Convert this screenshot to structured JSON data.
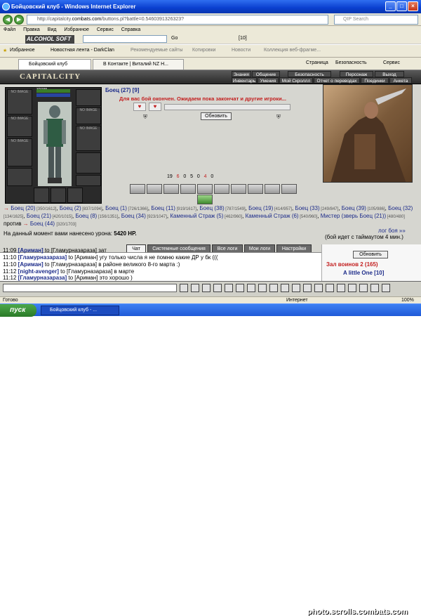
{
  "window": {
    "title": "Бойцовский клуб - Windows Internet Explorer",
    "min": "_",
    "max": "□",
    "close": "×"
  },
  "address": {
    "url_prefix": "http://capitalcity.",
    "url_domain": "combats.com",
    "url_path": "/buttons.pl?battle=0.5460391326323?",
    "search_placeholder": "QIP Search",
    "go": "Go"
  },
  "menu": [
    "Файл",
    "Правка",
    "Вид",
    "Избранное",
    "Сервис",
    "Справка"
  ],
  "toolbar": {
    "brand": "ALCOHOL SOFT",
    "counter": "[10]"
  },
  "favbar": {
    "favorites": "Избранное",
    "news": "Новостная лента - DarkClan",
    "recommended": "Рекомендуемые сайты",
    "kotirovki": "Котировки",
    "novosti": "Новости",
    "collection": "Коллекция веб-фрагме...",
    "page": "Страница",
    "security": "Безопасность",
    "service": "Сервис"
  },
  "tabs": [
    "Бойцовский клуб",
    "В Контакте | Виталий NZ Н..."
  ],
  "game": {
    "logo": "CAPITALCITY",
    "nav_top": [
      "Знания",
      "Общение",
      "Безопасность",
      "Персонаж",
      "Выход"
    ],
    "nav_bottom": [
      "Инвентарь",
      "Умения",
      "Мой Скроллл",
      "Отчет о переводах",
      "Поединки",
      "Анкета"
    ],
    "hp": "3?/155",
    "mana": "3?/155",
    "fighter_title": "Боец (27) [9]",
    "fight_over": "Для вас бой окончен. Ожидаем пока закончат и другие игроки...",
    "refresh": "Обновить",
    "noimage": "NO IMAGE",
    "stats": [
      "19",
      "6",
      "0",
      "5",
      "0",
      "4",
      "0"
    ],
    "damage_label": "На данный момент вами нанесено урона:",
    "damage_value": "5420 HP.",
    "log_link": "лог боя »»",
    "timeout_note": "(бой идет с таймаутом 4 мин.)"
  },
  "team_left": [
    {
      "name": "Боец (20)",
      "hp": "[350/1612]"
    },
    {
      "name": "Боец (2)",
      "hp": "[837/1094]"
    },
    {
      "name": "Боец (1)",
      "hp": "[726/1366]"
    },
    {
      "name": "Боец (11)",
      "hp": "[919/1617]"
    },
    {
      "name": "Боец (38)",
      "hp": "[787/1549]"
    },
    {
      "name": "Боец (19)",
      "hp": "[414/957]"
    },
    {
      "name": "Боец (33)",
      "hp": "[249/847]"
    },
    {
      "name": "Боец (39)",
      "hp": "[105/986]"
    },
    {
      "name": "Боец (32)",
      "hp": "[134/1625]"
    },
    {
      "name": "Боец (21)",
      "hp": "[420/1015]"
    },
    {
      "name": "Боец (8)",
      "hp": "[156/1351]"
    },
    {
      "name": "Боец (34)",
      "hp": "[923/1047]"
    },
    {
      "name": "Каменный Страж (5)",
      "hp": "[462/960]"
    },
    {
      "name": "Каменный Страж (6)",
      "hp": "[540/960]"
    },
    {
      "name": "Мистер (зверь Боец (21))",
      "hp": "[480/480]"
    }
  ],
  "versus": "против",
  "team_right": {
    "name": "Боец (44)",
    "hp": "[320/1703]"
  },
  "chat_tabs": [
    "Чат",
    "Системные сообщения",
    "Все логи",
    "Мои логи",
    "Настройки"
  ],
  "chat": [
    {
      "time": "11:09",
      "from": "[Ариман]",
      "to": "to [Гламурназараза]",
      "msg": "зат"
    },
    {
      "time": "11:10",
      "from": "[Гламурназараза]",
      "to": "to [Ариман]",
      "msg": "угу только числа я не помню какие ДР у бк (((",
      "bold": true
    },
    {
      "time": "11:10",
      "from": "[Ариман]",
      "to": "to [Гламурназараза]",
      "msg": "в районе великого 8-го марта :)"
    },
    {
      "time": "11:12",
      "from": "[night-avenger]",
      "to": "to [Гламурназараза]",
      "msg": "в марте"
    },
    {
      "time": "11:12",
      "from": "[Гламурназараза]",
      "to": "to [Ариман]",
      "msg": "это хорошо )",
      "bold": true
    }
  ],
  "right_chat": {
    "refresh": "Обновить",
    "header": "Зал воинов 2 (165)",
    "user": "A little One [10]"
  },
  "status": {
    "done": "Готово",
    "zone": "Интернет",
    "zoom": "100%"
  },
  "taskbar": {
    "start": "пуск",
    "item": "Бойцовский клуб - ...",
    "watermark": "photo.scrolls.combats.com"
  }
}
